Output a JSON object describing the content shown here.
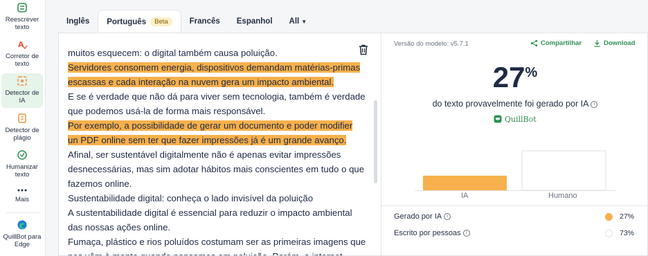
{
  "sidebar": {
    "items": [
      {
        "icon": "rewrite-icon",
        "label": "Reescrever texto"
      },
      {
        "icon": "grammar-icon",
        "label": "Corretor de texto"
      },
      {
        "icon": "ai-detector-icon",
        "label": "Detector de IA"
      },
      {
        "icon": "plagiarism-icon",
        "label": "Detector de plágio"
      },
      {
        "icon": "humanize-icon",
        "label": "Humanizar texto"
      },
      {
        "icon": "more-icon",
        "label": "Mais"
      },
      {
        "icon": "edge-icon",
        "label": "QuillBot para Edge"
      }
    ],
    "active_index": 2
  },
  "tabs": {
    "items": [
      "Inglês",
      "Português",
      "Francês",
      "Espanhol"
    ],
    "active": "Português",
    "beta": "Beta",
    "all": "All"
  },
  "editor": {
    "lines": [
      {
        "text": "muitos esquecem: o digital também causa poluição.",
        "highlight": false
      },
      {
        "text": "Servidores consomem energia, dispositivos demandam matérias-primas",
        "highlight": true
      },
      {
        "text": "escassas e cada interação na nuvem gera um impacto ambiental.",
        "highlight": true
      },
      {
        "text": "E se é verdade que não dá para viver sem tecnologia, também é verdade",
        "highlight": false
      },
      {
        "text": "que podemos usá-la de forma mais responsável.",
        "highlight": false
      },
      {
        "text": "Por exemplo, a possibilidade de gerar um documento e poder modifier",
        "highlight": true
      },
      {
        "text": "un PDF online sem ter que fazer impressões já é um grande avanço.",
        "highlight": true
      },
      {
        "text": "Afinal, ser sustentável digitalmente não é apenas evitar impressões",
        "highlight": false
      },
      {
        "text": "desnecessárias, mas sim adotar hábitos mais conscientes em tudo o que",
        "highlight": false
      },
      {
        "text": "fazemos online.",
        "highlight": false
      },
      {
        "text": "Sustentabilidade digital: conheça o lado invisível da poluição",
        "highlight": false
      },
      {
        "text": "A sustentabilidade digital é essencial para reduzir o impacto ambiental",
        "highlight": false
      },
      {
        "text": "das nossas ações online.",
        "highlight": false
      },
      {
        "text": "Fumaça, plástico e rios poluídos costumam ser as primeiras imagens que",
        "highlight": false
      },
      {
        "text": "nos vêm à mente quando pensamos em poluição. Porém, a internet",
        "highlight": false
      }
    ],
    "highlight_color": "#f7b04b"
  },
  "result": {
    "model_version": "Versão do modelo: v5.7.1",
    "share_label": "Compartilhar",
    "download_label": "Download",
    "percent_value": "27",
    "percent_sign": "%",
    "caption": "do texto provavelmente foi gerado por IA",
    "brand": "QuillBot",
    "chart_data": {
      "type": "bar",
      "categories": [
        "IA",
        "Humano"
      ],
      "values": [
        27,
        73
      ],
      "colors": [
        "#f7b04b",
        "#ffffff"
      ],
      "ylim": [
        0,
        73
      ]
    },
    "legend": [
      {
        "label": "Gerado por IA",
        "value": "27%",
        "color": "#f7b04b"
      },
      {
        "label": "Escrito por pessoas",
        "value": "73%",
        "color": "#ffffff"
      }
    ]
  },
  "colors": {
    "accent_green": "#2f8f55",
    "active_bg": "#e6f4ea"
  }
}
